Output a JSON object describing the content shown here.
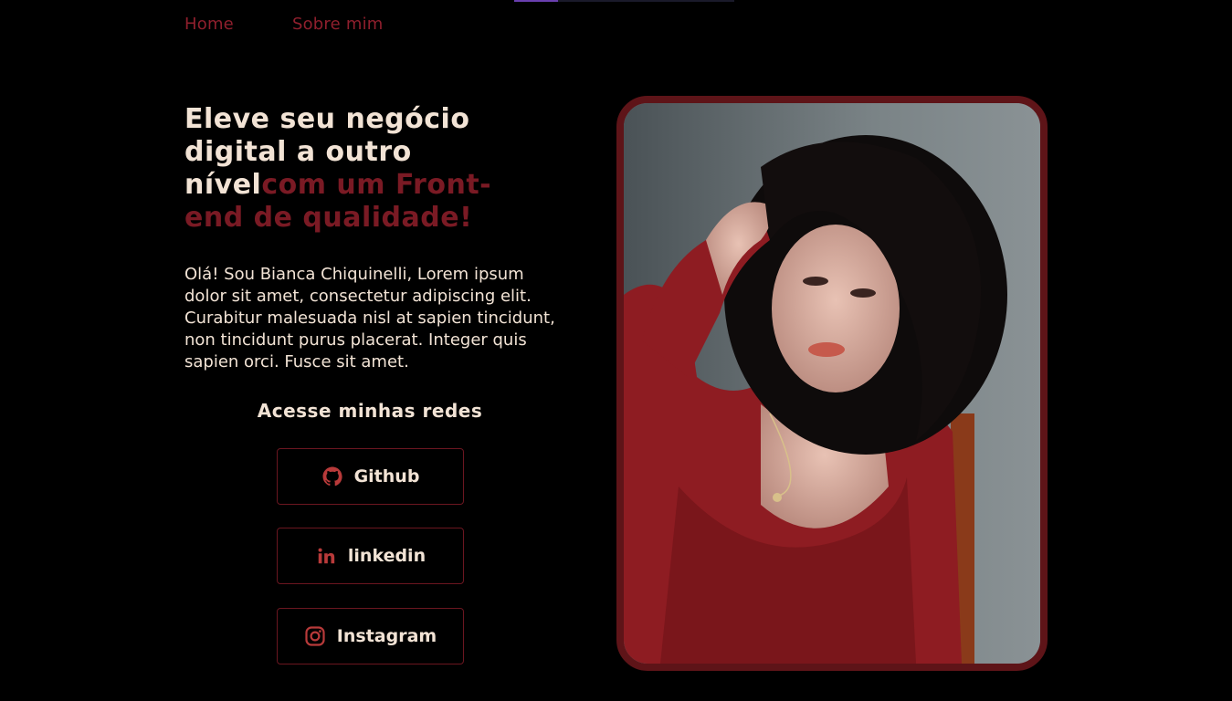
{
  "nav": {
    "home": "Home",
    "about": "Sobre mim"
  },
  "hero": {
    "title_main": "Eleve seu negócio digital a outro nível",
    "title_accent": "com um Front-end de qualidade!",
    "intro": "Olá! Sou Bianca Chiquinelli, Lorem ipsum dolor sit amet, consectetur adipiscing elit. Curabitur malesuada nisl at sapien tincidunt, non tincidunt purus placerat. Integer quis sapien orci. Fusce sit amet."
  },
  "social": {
    "heading": "Acesse minhas redes",
    "buttons": [
      {
        "label": "Github",
        "icon": "github-icon"
      },
      {
        "label": "linkedin",
        "icon": "linkedin-icon"
      },
      {
        "label": "Instagram",
        "icon": "instagram-icon"
      }
    ]
  },
  "colors": {
    "background": "#000000",
    "accent": "#7a1a24",
    "text": "#f2e3d5",
    "frame": "#5e1418"
  },
  "portrait": {
    "icon": "portrait-photo"
  }
}
